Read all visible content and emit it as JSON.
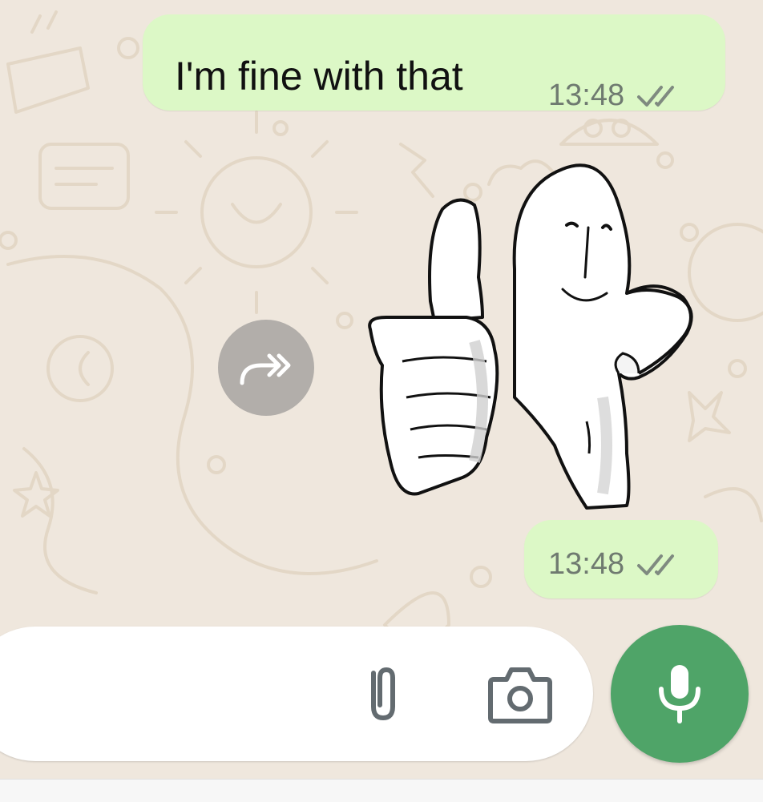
{
  "messages": [
    {
      "text": "I'm fine with that",
      "time": "13:48",
      "status": "read"
    },
    {
      "type": "sticker",
      "sticker_description": "hand-drawn thumbs-up character",
      "time": "13:48",
      "status": "read"
    }
  ],
  "icons": {
    "forward": "forward-icon",
    "attach": "paperclip-icon",
    "camera": "camera-icon",
    "mic": "microphone-icon",
    "ticks": "double-check-icon"
  },
  "colors": {
    "chat_background": "#efe7dd",
    "outgoing_bubble": "#dcf8c6",
    "mic_button": "#4fa468",
    "input_bar": "#ffffff"
  }
}
